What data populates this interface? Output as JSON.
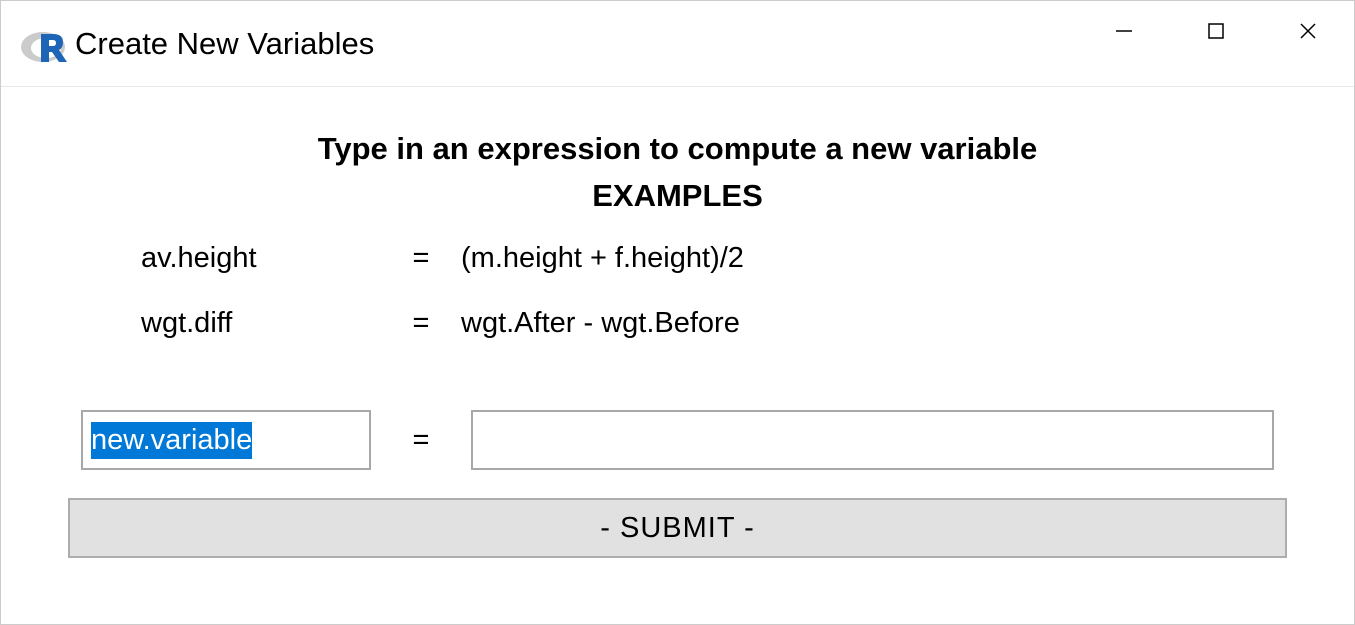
{
  "window": {
    "title": "Create New Variables"
  },
  "content": {
    "heading": "Type in an expression to compute a new variable",
    "subheading": "EXAMPLES",
    "examples": [
      {
        "name": "av.height",
        "eq": "=",
        "expr": "(m.height + f.height)/2"
      },
      {
        "name": "wgt.diff",
        "eq": "=",
        "expr": "wgt.After - wgt.Before"
      }
    ],
    "input": {
      "var_name": "new.variable",
      "eq": "=",
      "expr": ""
    },
    "submit_label": "- SUBMIT -"
  }
}
